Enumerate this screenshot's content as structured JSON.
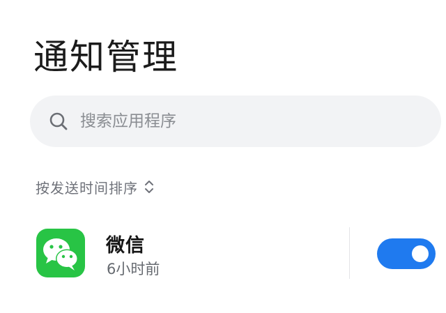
{
  "header": {
    "title": "通知管理"
  },
  "search": {
    "placeholder": "搜索应用程序",
    "icon": "search-icon"
  },
  "sort": {
    "label": "按发送时间排序",
    "icon": "chevron-up-down-icon"
  },
  "apps": [
    {
      "name": "微信",
      "last_notification": "6小时前",
      "icon": "wechat-icon",
      "notifications_enabled": true
    }
  ],
  "colors": {
    "toggle_on": "#1f7aef",
    "wechat_green": "#28c445",
    "search_bg": "#f2f3f5"
  }
}
